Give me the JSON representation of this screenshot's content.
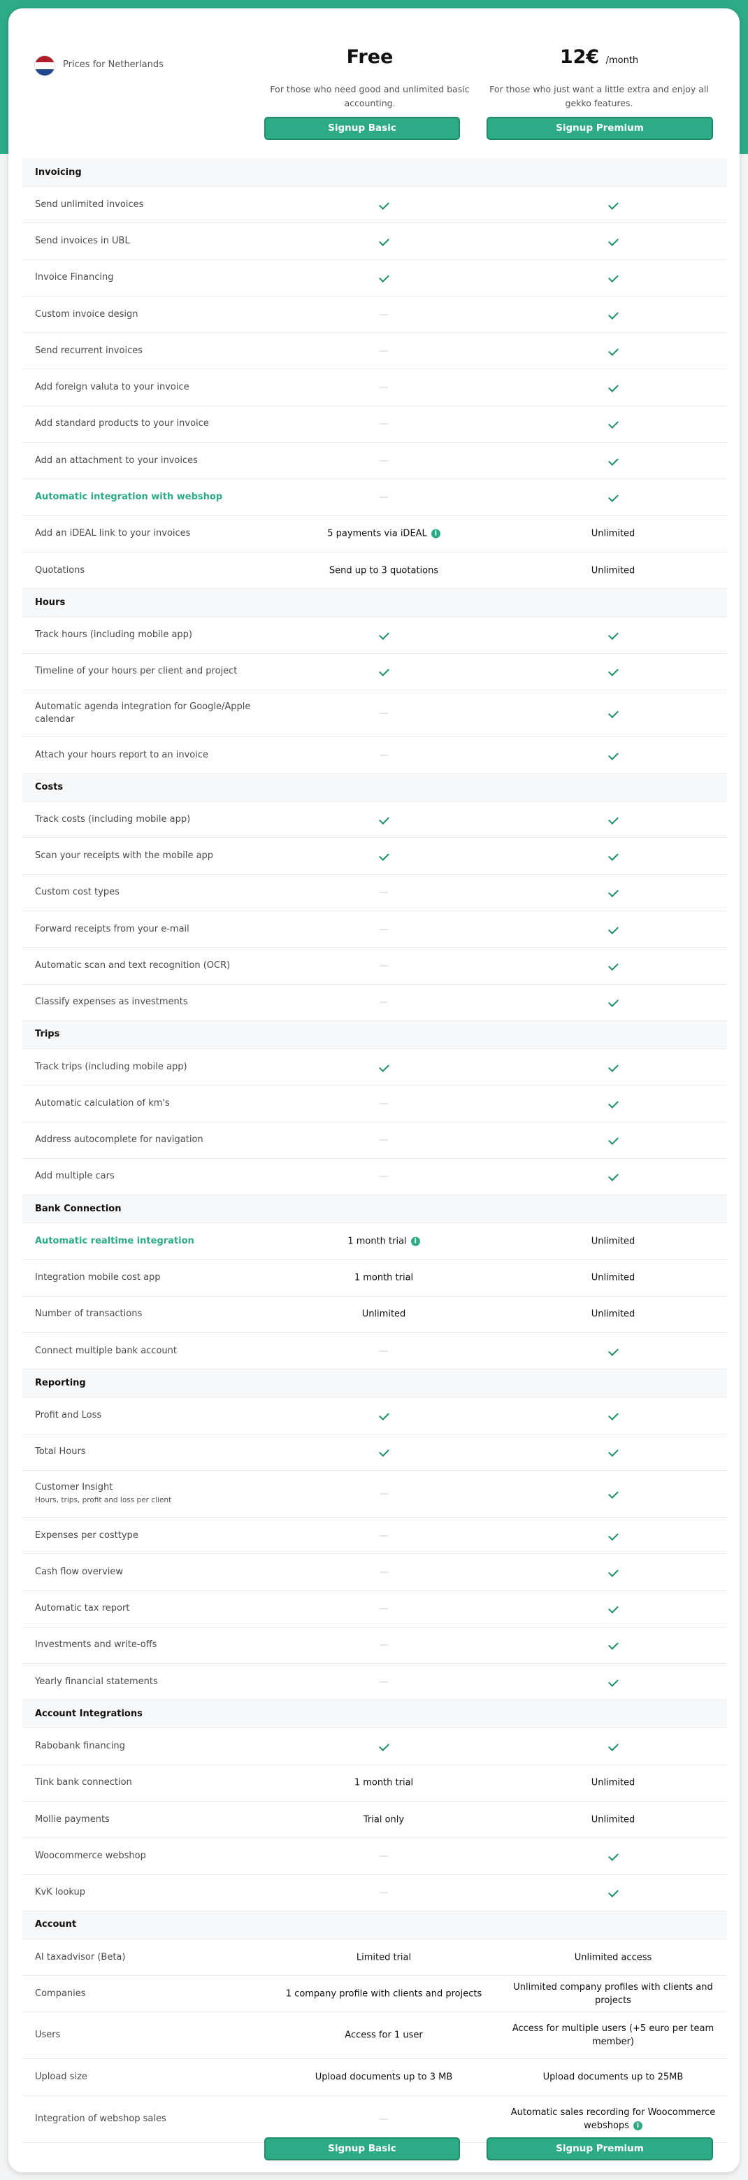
{
  "region": "Prices for Netherlands",
  "plans": {
    "free": {
      "name": "Free",
      "desc": "For those who need good and unlimited basic accounting.",
      "button": "Signup Basic"
    },
    "premium": {
      "price": "12€",
      "unit": "/month",
      "desc": "For those who just want a little extra and enjoy all gekko features.",
      "button": "Signup Premium"
    }
  },
  "rows": [
    {
      "type": "section",
      "label": "Invoicing"
    },
    {
      "label": "Send unlimited invoices",
      "free": "check",
      "premium": "check"
    },
    {
      "label": "Send invoices in UBL",
      "free": "check",
      "premium": "check"
    },
    {
      "label": "Invoice Financing",
      "free": "check",
      "premium": "check"
    },
    {
      "label": "Custom invoice design",
      "free": "dash",
      "premium": "check"
    },
    {
      "label": "Send recurrent invoices",
      "free": "dash",
      "premium": "check"
    },
    {
      "label": "Add foreign valuta to your invoice",
      "free": "dash",
      "premium": "check"
    },
    {
      "label": "Add standard products to your invoice",
      "free": "dash",
      "premium": "check"
    },
    {
      "label": "Add an attachment to your invoices",
      "free": "dash",
      "premium": "check"
    },
    {
      "label": "Automatic integration with webshop",
      "link": true,
      "free": "dash",
      "premium": "check"
    },
    {
      "label": "Add an iDEAL link to your invoices",
      "free": "5 payments via iDEAL",
      "freeInfo": true,
      "premium": "Unlimited"
    },
    {
      "label": "Quotations",
      "free": "Send up to 3 quotations",
      "premium": "Unlimited"
    },
    {
      "type": "section",
      "label": "Hours"
    },
    {
      "label": "Track hours (including mobile app)",
      "free": "check",
      "premium": "check"
    },
    {
      "label": "Timeline of your hours per client and project",
      "free": "check",
      "premium": "check"
    },
    {
      "label": "Automatic agenda integration for Google/Apple calendar",
      "tall": true,
      "free": "dash",
      "premium": "check"
    },
    {
      "label": "Attach your hours report to an invoice",
      "free": "dash",
      "premium": "check"
    },
    {
      "type": "section",
      "label": "Costs"
    },
    {
      "label": "Track costs (including mobile app)",
      "free": "check",
      "premium": "check"
    },
    {
      "label": "Scan your receipts with the mobile app",
      "free": "check",
      "premium": "check"
    },
    {
      "label": "Custom cost types",
      "free": "dash",
      "premium": "check"
    },
    {
      "label": "Forward receipts from your e-mail",
      "free": "dash",
      "premium": "check"
    },
    {
      "label": "Automatic scan and text recognition (OCR)",
      "free": "dash",
      "premium": "check"
    },
    {
      "label": "Classify expenses as investments",
      "free": "dash",
      "premium": "check"
    },
    {
      "type": "section",
      "label": "Trips"
    },
    {
      "label": "Track trips (including mobile app)",
      "free": "check",
      "premium": "check"
    },
    {
      "label": "Automatic calculation of km's",
      "free": "dash",
      "premium": "check"
    },
    {
      "label": "Address autocomplete for navigation",
      "free": "dash",
      "premium": "check"
    },
    {
      "label": "Add multiple cars",
      "free": "dash",
      "premium": "check"
    },
    {
      "type": "section",
      "label": "Bank Connection"
    },
    {
      "label": "Automatic realtime integration",
      "link": true,
      "free": "1 month trial",
      "freeInfo": true,
      "premium": "Unlimited"
    },
    {
      "label": "Integration mobile cost app",
      "free": "1 month trial",
      "premium": "Unlimited"
    },
    {
      "label": "Number of transactions",
      "free": "Unlimited",
      "premium": "Unlimited"
    },
    {
      "label": "Connect multiple bank account",
      "free": "dash",
      "premium": "check"
    },
    {
      "type": "section",
      "label": "Reporting"
    },
    {
      "label": "Profit and Loss",
      "free": "check",
      "premium": "check"
    },
    {
      "label": "Total Hours",
      "free": "check",
      "premium": "check"
    },
    {
      "label": "Customer Insight",
      "sub": "Hours, trips, profit and loss per client",
      "tall": true,
      "free": "dash",
      "premium": "check"
    },
    {
      "label": "Expenses per costtype",
      "free": "dash",
      "premium": "check"
    },
    {
      "label": "Cash flow overview",
      "free": "dash",
      "premium": "check"
    },
    {
      "label": "Automatic tax report",
      "free": "dash",
      "premium": "check"
    },
    {
      "label": "Investments and write-offs",
      "free": "dash",
      "premium": "check"
    },
    {
      "label": "Yearly financial statements",
      "free": "dash",
      "premium": "check"
    },
    {
      "type": "section",
      "label": "Account Integrations"
    },
    {
      "label": "Rabobank financing",
      "free": "check",
      "premium": "check"
    },
    {
      "label": "Tink bank connection",
      "free": "1 month trial",
      "premium": "Unlimited"
    },
    {
      "label": "Mollie payments",
      "free": "Trial only",
      "premium": "Unlimited"
    },
    {
      "label": "Woocommerce webshop",
      "free": "dash",
      "premium": "check"
    },
    {
      "label": "KvK lookup",
      "free": "dash",
      "premium": "check"
    },
    {
      "type": "section",
      "label": "Account"
    },
    {
      "label": "AI taxadvisor (Beta)",
      "free": "Limited trial",
      "premium": "Unlimited access"
    },
    {
      "label": "Companies",
      "free": "1 company profile with clients and projects",
      "premium": "Unlimited company profiles with clients and projects"
    },
    {
      "label": "Users",
      "tall": true,
      "free": "Access for 1 user",
      "premium": "Access for multiple users (+5 euro per team member)"
    },
    {
      "label": "Upload size",
      "free": "Upload documents up to 3 MB",
      "premium": "Upload documents up to 25MB"
    },
    {
      "label": "Integration of webshop sales",
      "tall": true,
      "free": "dash",
      "premium": "Automatic sales recording for Woocommerce webshops",
      "premiumInfo": true
    }
  ],
  "colors": {
    "brand": "#2daa86",
    "check": "#1b8f66"
  },
  "flag": [
    "#ae1c28",
    "#ffffff",
    "#21468b"
  ]
}
